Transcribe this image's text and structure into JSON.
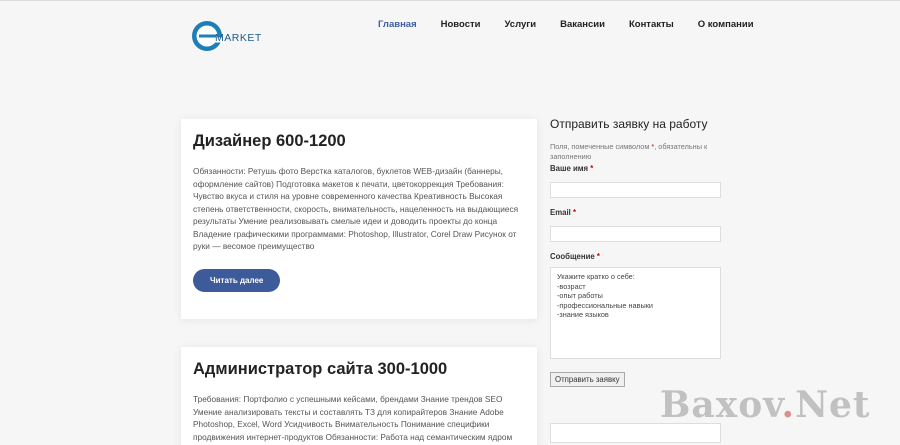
{
  "header": {
    "logo_text": "MARKET",
    "nav": [
      {
        "label": "Главная",
        "active": true
      },
      {
        "label": "Новости",
        "active": false
      },
      {
        "label": "Услуги",
        "active": false
      },
      {
        "label": "Вакансии",
        "active": false
      },
      {
        "label": "Контакты",
        "active": false
      },
      {
        "label": "О компании",
        "active": false
      }
    ]
  },
  "posts": [
    {
      "title": "Дизайнер 600-1200",
      "body": "Обязанности:   Ретушь фото Верстка каталогов, буклетов WEB-дизайн (баннеры, оформление сайтов) Подготовка макетов к печати, цветокоррекция Требования: Чувство вкуса и стиля на уровне современного качества Креативность Высокая степень ответственности, скорость, внимательность, нацеленность на выдающиеся результаты Умение реализовывать смелые идеи и доводить проекты до конца Владение графическими программами: Photoshop, Illustrator, Corel Draw Рисунок от руки — весомое преимущество",
      "button": "Читать далее"
    },
    {
      "title": "Администратор сайта 300-1000",
      "body": "Требования:   Портфолио с успешными кейсами, брендами Знание трендов SEO Умение анализировать тексты и составлять ТЗ для копирайтеров Знание Adobe Photoshop, Excel, Word Усидчивость Внимательность Понимание специфики продвижения интернет-продуктов Обязанности:   Работа над семантическим ядром проекта (включая"
    }
  ],
  "form": {
    "title": "Отправить заявку на работу",
    "note_prefix": "Поля, помеченные символом ",
    "note_star": "*",
    "note_suffix": ", обязательны к заполнению",
    "name_label": "Ваше имя",
    "email_label": "Email",
    "message_label": "Сообщение",
    "star": "*",
    "message_value": "Укажите кратко о себе:\n-возраст\n-опыт работы\n-профессиональные навыки\n-знание языков",
    "submit_label": "Отправить заявку"
  },
  "watermark": {
    "part1": "Baxov",
    "dot": ".",
    "part2": "Net"
  },
  "colors": {
    "accent": "#3d5a9b",
    "logo": "#1e7fb8"
  }
}
